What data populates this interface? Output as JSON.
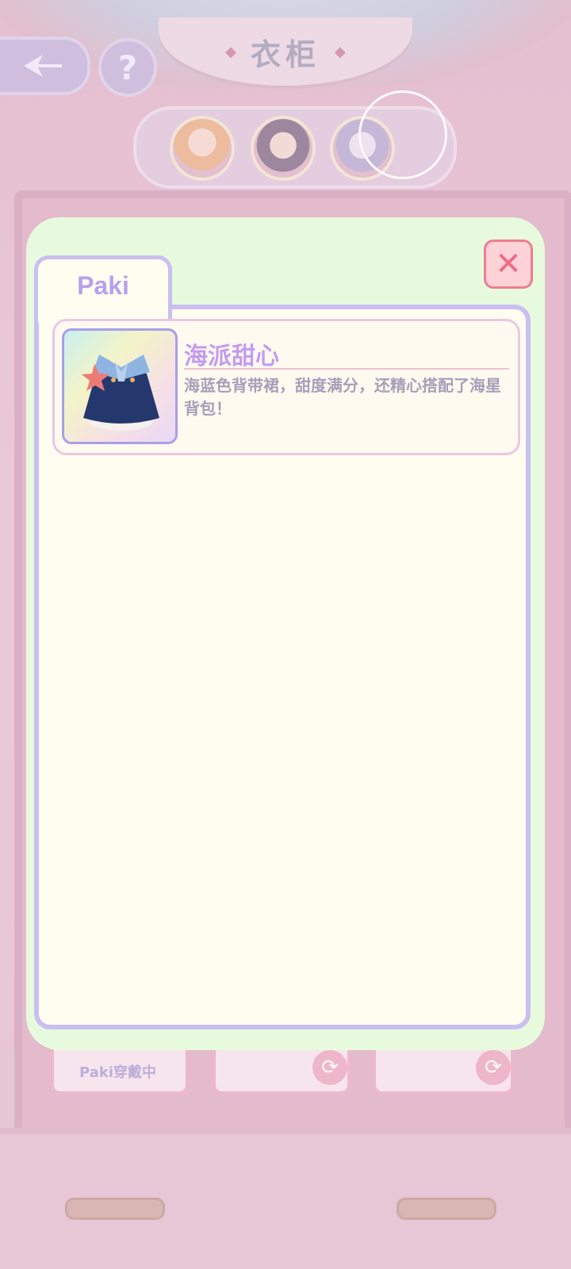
{
  "header": {
    "title": "衣柜",
    "back_icon": "back-arrow-icon",
    "help_label": "?"
  },
  "characters": [
    {
      "name": "character-avatar-1",
      "selected": false
    },
    {
      "name": "character-avatar-2",
      "selected": false
    },
    {
      "name": "character-avatar-3",
      "selected": false
    }
  ],
  "wardrobe": {
    "slot_label": "Paki穿戴中",
    "cycle_icon": "cycle-icon"
  },
  "dialog": {
    "tab_label": "Paki",
    "close_label": "✕",
    "items": [
      {
        "name": "海派甜心",
        "description": "海蓝色背带裙，甜度满分，还精心搭配了海星背包！",
        "icon": "dress-icon"
      }
    ]
  },
  "colors": {
    "dialog_bg": "#e8fade",
    "panel_border": "#c9bff0",
    "item_title": "#c39cf0",
    "close_accent": "#f06a85"
  }
}
